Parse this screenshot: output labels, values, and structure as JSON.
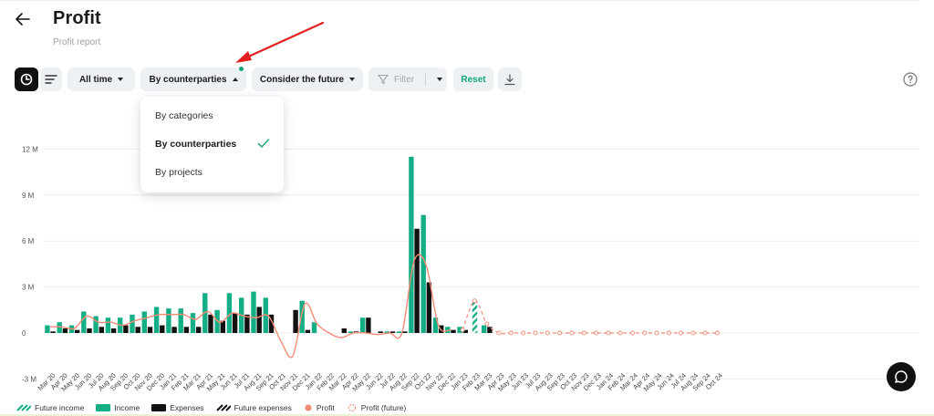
{
  "header": {
    "title": "Profit",
    "subtitle": "Profit report"
  },
  "toolbar": {
    "period": "All time",
    "grouping": "By counterparties",
    "future_mode": "Consider the future",
    "filter_placeholder": "Filter",
    "reset_label": "Reset"
  },
  "dropdown": {
    "items": [
      {
        "label": "By categories",
        "selected": false
      },
      {
        "label": "By counterparties",
        "selected": true
      },
      {
        "label": "By projects",
        "selected": false
      }
    ]
  },
  "annotation": {
    "arrow_color": "#e32020"
  },
  "colors": {
    "income": "#13ad86",
    "expenses": "#111111",
    "profit": "#f28c75",
    "accent": "#16a67a"
  },
  "legend": [
    {
      "label": "Future income",
      "kind": "hatch-green"
    },
    {
      "label": "Income",
      "kind": "solid-green"
    },
    {
      "label": "Expenses",
      "kind": "solid-black"
    },
    {
      "label": "Future expenses",
      "kind": "hatch-black"
    },
    {
      "label": "Profit",
      "kind": "dot-profit"
    },
    {
      "label": "Profit (future)",
      "kind": "dashed-profit"
    }
  ],
  "chart_data": {
    "type": "bar",
    "ylim": [
      -3,
      12
    ],
    "yticks": [
      -3,
      0,
      3,
      6,
      9,
      12
    ],
    "ytick_labels": [
      "-3 M",
      "0",
      "3 M",
      "6 M",
      "9 M",
      "12 M"
    ],
    "grid": true,
    "categories": [
      "Mar 20",
      "Apr 20",
      "May 20",
      "Jun 20",
      "Jul 20",
      "Aug 20",
      "Sep 20",
      "Oct 20",
      "Nov 20",
      "Dec 20",
      "Jan 21",
      "Feb 21",
      "Mar 21",
      "Apr 21",
      "May 21",
      "Jun 21",
      "Jul 21",
      "Aug 21",
      "Sep 21",
      "Oct 21",
      "Nov 21",
      "Dec 21",
      "Jan 22",
      "Feb 22",
      "Mar 22",
      "Apr 22",
      "May 22",
      "Jun 22",
      "Jul 22",
      "Aug 22",
      "Sep 22",
      "Oct 22",
      "Nov 22",
      "Dec 22",
      "Jan 23",
      "Feb 23",
      "Mar 23",
      "Apr 23",
      "May 23",
      "Jun 23",
      "Jul 23",
      "Aug 23",
      "Sep 23",
      "Oct 23",
      "Nov 23",
      "Dec 23",
      "Jan 24",
      "Feb 24",
      "Mar 24",
      "Apr 24",
      "May 24",
      "Jun 24",
      "Jul 24",
      "Aug 24",
      "Sep 24",
      "Oct 24"
    ],
    "series": [
      {
        "name": "Income",
        "values": [
          0.5,
          0.7,
          0.5,
          1.4,
          1.1,
          1.0,
          1.0,
          1.2,
          1.4,
          1.7,
          1.6,
          1.6,
          1.3,
          2.6,
          1.5,
          2.6,
          2.3,
          2.7,
          2.3,
          0,
          0,
          2.1,
          0.7,
          0,
          0,
          0.1,
          1.0,
          0,
          0.1,
          0.1,
          11.5,
          7.7,
          1.0,
          0.4,
          0.4,
          0,
          0.5,
          0,
          0,
          0,
          0,
          0,
          0,
          0,
          0,
          0,
          0,
          0,
          0,
          0,
          0,
          0,
          0,
          0,
          0,
          0
        ]
      },
      {
        "name": "Expenses",
        "values": [
          0.1,
          0.3,
          0.2,
          0.3,
          0.4,
          0.3,
          0.5,
          0.4,
          0.4,
          0.5,
          0.4,
          0.4,
          0.4,
          1.2,
          0.8,
          1.3,
          1.2,
          1.7,
          1.2,
          0,
          1.5,
          0.2,
          0,
          0,
          0.3,
          0.1,
          1.0,
          0.1,
          0.1,
          0.1,
          6.8,
          3.3,
          0.5,
          0.2,
          0.2,
          0,
          0.4,
          0,
          0,
          0,
          0,
          0,
          0,
          0,
          0,
          0,
          0,
          0,
          0,
          0,
          0,
          0,
          0,
          0,
          0,
          0
        ]
      },
      {
        "name": "Future income",
        "values": [
          0,
          0,
          0,
          0,
          0,
          0,
          0,
          0,
          0,
          0,
          0,
          0,
          0,
          0,
          0,
          0,
          0,
          0,
          0,
          0,
          0,
          0,
          0,
          0,
          0,
          0,
          0,
          0,
          0,
          0,
          0,
          0,
          0,
          0,
          0,
          2.1,
          0,
          0,
          0,
          0,
          0,
          0,
          0,
          0,
          0,
          0,
          0,
          0,
          0,
          0,
          0,
          0,
          0,
          0,
          0,
          0
        ]
      },
      {
        "name": "Future expenses",
        "values": [
          0,
          0,
          0,
          0,
          0,
          0,
          0,
          0,
          0,
          0,
          0,
          0,
          0,
          0,
          0,
          0,
          0,
          0,
          0,
          0,
          0,
          0,
          0,
          0,
          0,
          0,
          0,
          0,
          0,
          0,
          0,
          0,
          0,
          0,
          0,
          0,
          0,
          0,
          0,
          0,
          0,
          0,
          0,
          0,
          0,
          0,
          0,
          0,
          0,
          0,
          0,
          0,
          0,
          0,
          0,
          0
        ]
      },
      {
        "name": "Profit",
        "values": [
          0.4,
          0.4,
          0.3,
          1.1,
          0.7,
          0.7,
          0.5,
          0.8,
          1.0,
          1.2,
          1.2,
          1.2,
          0.9,
          1.4,
          0.7,
          1.3,
          1.1,
          1.0,
          1.1,
          -0.5,
          -1.5,
          1.9,
          0.6,
          0,
          -0.3,
          0,
          0,
          -0.1,
          0,
          0,
          4.7,
          4.4,
          0.5,
          0.2,
          0.2,
          0,
          0.1,
          0,
          0,
          0,
          0,
          0,
          0,
          0,
          0,
          0,
          0,
          0,
          0,
          0,
          0,
          0,
          0,
          0,
          0,
          0
        ]
      },
      {
        "name": "Profit (future)",
        "values": [
          null,
          null,
          null,
          null,
          null,
          null,
          null,
          null,
          null,
          null,
          null,
          null,
          null,
          null,
          null,
          null,
          null,
          null,
          null,
          null,
          null,
          null,
          null,
          null,
          null,
          null,
          null,
          null,
          null,
          null,
          null,
          null,
          null,
          null,
          0.2,
          2.1,
          0.6,
          0,
          0,
          0,
          0,
          0,
          0,
          0,
          0,
          0,
          0,
          0,
          0,
          0,
          0,
          0,
          0,
          0,
          0,
          0
        ]
      }
    ]
  }
}
